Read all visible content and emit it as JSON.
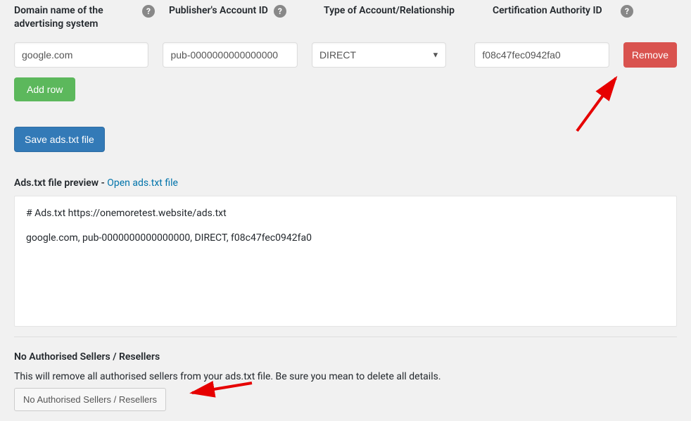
{
  "labels": {
    "domain": "Domain name of the advertising system",
    "publisher": "Publisher's Account ID",
    "type": "Type of Account/Relationship",
    "cert": "Certification Authority ID"
  },
  "row": {
    "domain": "google.com",
    "publisher": "pub-0000000000000000",
    "type": "DIRECT",
    "cert": "f08c47fec0942fa0"
  },
  "buttons": {
    "remove": "Remove",
    "add_row": "Add row",
    "save": "Save ads.txt file",
    "no_auth": "No Authorised Sellers / Resellers"
  },
  "preview": {
    "heading_prefix": "Ads.txt file preview",
    "heading_sep": " - ",
    "open_link": "Open ads.txt file",
    "line1": "# Ads.txt https://onemoretest.website/ads.txt",
    "line2": "google.com, pub-0000000000000000, DIRECT, f08c47fec0942fa0"
  },
  "noauth": {
    "heading": "No Authorised Sellers / Resellers",
    "desc": "This will remove all authorised sellers from your ads.txt file. Be sure you mean to delete all details."
  },
  "help_glyph": "?"
}
